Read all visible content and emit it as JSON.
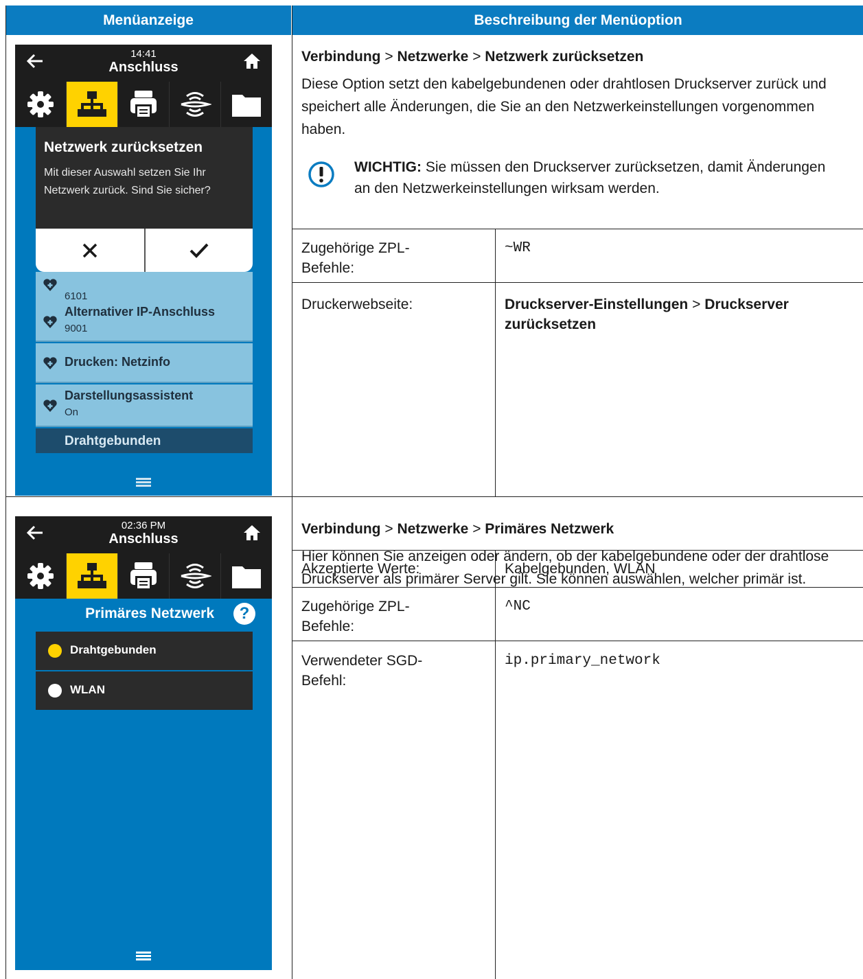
{
  "header": {
    "col1": "Menüanzeige",
    "col2": "Beschreibung der Menüoption"
  },
  "row1": {
    "screen": {
      "time": "14:41",
      "title": "Anschluss",
      "dialog_title": "Netzwerk zurücksetzen",
      "dialog_text": "Mit dieser Auswahl setzen Sie Ihr Netzwerk zurück. Sind Sie sicher?",
      "partial_item_value": "6101",
      "items": [
        {
          "title": "Alternativer IP-Anschluss",
          "sub": "9001"
        },
        {
          "title": "Drucken: Netzinfo",
          "sub": ""
        },
        {
          "title": "Darstellungsassistent",
          "sub": "On"
        }
      ],
      "section": "Drahtgebunden"
    },
    "path": {
      "a": "Verbindung",
      "sep": ">",
      "b": "Netzwerke",
      "c": "Netzwerk zurücksetzen"
    },
    "description": "Diese Option setzt den kabelgebundenen oder drahtlosen Druckserver zurück und speichert alle Änderungen, die Sie an den Netzwerkeinstellungen vorgenommen haben.",
    "important_label": "WICHTIG:",
    "important_text": "Sie müssen den Druckserver zurücksetzen, damit Änderungen an den Netzwerkeinstellungen wirksam werden.",
    "zpl_label": "Zugehörige ZPL-Befehle:",
    "zpl_value": "~WR",
    "web_label": "Druckerwebseite:",
    "web_value_a": "Druckserver-Einstellungen",
    "web_sep": ">",
    "web_value_b": "Druckserver zurücksetzen"
  },
  "row2": {
    "screen": {
      "time": "02:36 PM",
      "title": "Anschluss",
      "heading": "Primäres Netzwerk",
      "help": "?",
      "options": [
        {
          "label": "Drahtgebunden",
          "selected": true
        },
        {
          "label": "WLAN",
          "selected": false
        }
      ]
    },
    "path": {
      "a": "Verbindung",
      "sep": ">",
      "b": "Netzwerke",
      "c": "Primäres Netzwerk"
    },
    "description": "Hier können Sie anzeigen oder ändern, ob der kabelgebundene oder der drahtlose Druckserver als primärer Server gilt. Sie können auswählen, welcher primär ist.",
    "accepted_label": "Akzeptierte Werte:",
    "accepted_value": "Kabelgebunden, WLAN",
    "zpl_label": "Zugehörige ZPL-Befehle:",
    "zpl_value": "^NC",
    "sgd_label": "Verwendeter SGD-Befehl:",
    "sgd_value": "ip.primary_network"
  },
  "colors": {
    "header_blue": "#0b7cc1",
    "screen_blue": "#0079bd",
    "active_tab": "#ffd200",
    "list_item": "#88c3df"
  }
}
